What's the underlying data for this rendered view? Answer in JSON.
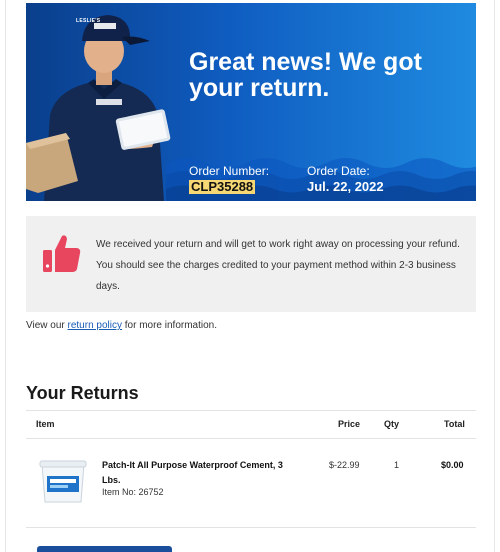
{
  "hero": {
    "logo_text": "LESLIE'S",
    "headline": "Great news! We got your return.",
    "order_number_label": "Order Number:",
    "order_number": "CLP35288",
    "order_date_label": "Order Date:",
    "order_date": "Jul. 22, 2022",
    "colors": {
      "gradient_start": "#0a3f8c",
      "gradient_end": "#1f8be0",
      "highlight": "#f7d774"
    }
  },
  "notice": {
    "icon": "thumbs-up-icon",
    "icon_color": "#e8455f",
    "text": "We received your return and will get to work right away on processing your refund. You should see the charges credited to your payment method within 2-3 business days."
  },
  "policy": {
    "prefix": "View our",
    "link_text": "return policy",
    "suffix": "for more information."
  },
  "returns": {
    "title": "Your Returns",
    "columns": {
      "item": "Item",
      "price": "Price",
      "qty": "Qty",
      "total": "Total"
    },
    "items": [
      {
        "name": "Patch-It All Purpose Waterproof Cement, 3 Lbs.",
        "item_no": "Item No: 26752",
        "price": "$-22.99",
        "qty": "1",
        "total": "$0.00",
        "image_icon": "product-bucket-icon"
      }
    ]
  },
  "accent_color": "#1b4e9b"
}
